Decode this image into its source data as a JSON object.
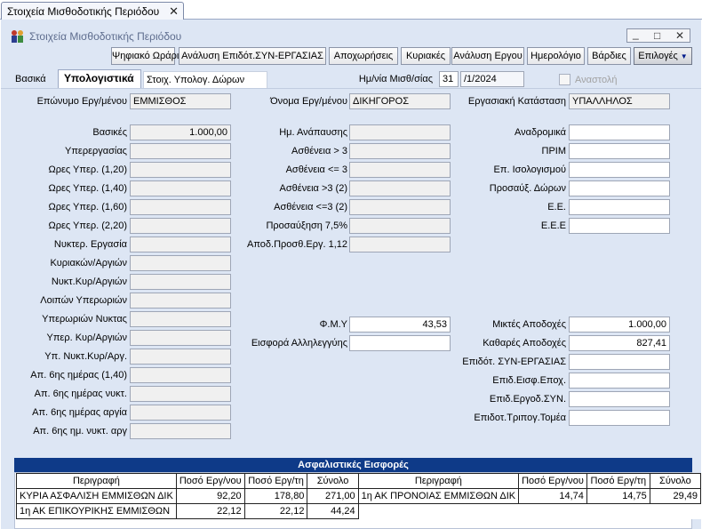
{
  "doc_tab": {
    "title": "Στοιχεία Μισθοδοτικής Περιόδου",
    "close": "✕"
  },
  "window": {
    "title": "Στοιχεία Μισθοδοτικής Περιόδου",
    "minimize": "_",
    "restore": "□",
    "close": "✕"
  },
  "toolbar": [
    "Ψηφιακό Ωράριο",
    "Ανάλυση Επιδότ.ΣΥΝ-ΕΡΓΑΣΙΑΣ",
    "Αποχωρήσεις",
    "Κυριακές",
    "Ανάλυση Εργου",
    "Ημερολόγιο",
    "Βάρδιες",
    "Επιλογές"
  ],
  "tabs": [
    "Βασικά",
    "Υπολογιστικά",
    "Στοιχ. Υπολογ. Δώρων"
  ],
  "payroll_date": {
    "label": "Ημ/νία Μισθ/σίας",
    "day": "31",
    "rest": "/1/2024"
  },
  "suspension": {
    "label": "Αναστολή"
  },
  "header_fields": {
    "surname_label": "Επώνυμο Εργ/μένου",
    "surname": "ΕΜΜΙΣΘΟΣ",
    "name_label": "Όνομα Εργ/μένου",
    "name": "ΔΙΚΗΓΟΡΟΣ",
    "status_label": "Εργασιακή Κατάσταση",
    "status": "ΥΠΑΛΛΗΛΟΣ"
  },
  "col1": [
    {
      "label": "Βασικές",
      "value": "1.000,00"
    },
    {
      "label": "Υπερεργασίας",
      "value": ""
    },
    {
      "label": "Ωρες Υπερ. (1,20)",
      "value": ""
    },
    {
      "label": "Ωρες Υπερ. (1,40)",
      "value": ""
    },
    {
      "label": "Ωρες Υπερ. (1,60)",
      "value": ""
    },
    {
      "label": "Ωρες Υπερ. (2,20)",
      "value": ""
    },
    {
      "label": "Νυκτερ. Εργασία",
      "value": ""
    },
    {
      "label": "Κυριακών/Αργιών",
      "value": ""
    },
    {
      "label": "Νυκτ.Κυρ/Αργιών",
      "value": ""
    },
    {
      "label": "Λοιπών Υπερωριών",
      "value": ""
    },
    {
      "label": "Υπερωριών Νυκτας",
      "value": ""
    },
    {
      "label": "Υπερ. Κυρ/Αργιών",
      "value": ""
    },
    {
      "label": "Υπ. Νυκτ.Κυρ/Αργ.",
      "value": ""
    },
    {
      "label": "Απ. 6ης ημέρας (1,40)",
      "value": ""
    },
    {
      "label": "Απ. 6ης ημέρας νυκτ.",
      "value": ""
    },
    {
      "label": "Απ. 6ης ημέρας αργία",
      "value": ""
    },
    {
      "label": "Απ. 6ης ημ. νυκτ. αργ",
      "value": ""
    }
  ],
  "col2": [
    {
      "label": "Ημ. Ανάπαυσης",
      "value": ""
    },
    {
      "label": "Ασθένεια > 3",
      "value": ""
    },
    {
      "label": "Ασθένεια <= 3",
      "value": ""
    },
    {
      "label": "Ασθένεια >3 (2)",
      "value": ""
    },
    {
      "label": "Ασθένεια <=3 (2)",
      "value": ""
    },
    {
      "label": "Προσαύξηση 7,5%",
      "value": ""
    },
    {
      "label": "Αποδ.Προσθ.Εργ. 1,12",
      "value": ""
    }
  ],
  "col2_bottom": [
    {
      "label": "Φ.Μ.Υ",
      "value": "43,53"
    },
    {
      "label": "Εισφορά Αλληλεγγύης",
      "value": ""
    }
  ],
  "col3": [
    {
      "label": "Αναδρομικά",
      "value": ""
    },
    {
      "label": "ΠΡΙΜ",
      "value": ""
    },
    {
      "label": "Επ. Ισολογισμού",
      "value": ""
    },
    {
      "label": "Προσαύξ. Δώρων",
      "value": ""
    },
    {
      "label": "Ε.Ε.",
      "value": ""
    },
    {
      "label": "Ε.Ε.Ε",
      "value": ""
    }
  ],
  "col3_bottom": [
    {
      "label": "Μικτές Αποδοχές",
      "value": "1.000,00"
    },
    {
      "label": "Καθαρές Αποδοχές",
      "value": "827,41"
    },
    {
      "label": "Επιδότ. ΣΥΝ-ΕΡΓΑΣΙΑΣ",
      "value": ""
    },
    {
      "label": "Επιδ.Εισφ.Εποχ.",
      "value": ""
    },
    {
      "label": "Επιδ.Εργοδ.ΣΥΝ.",
      "value": ""
    },
    {
      "label": "Επιδοτ.Τριπογ.Τομέα",
      "value": ""
    }
  ],
  "insurance": {
    "title": "Ασφαλιστικές Εισφορές",
    "headers": [
      "Περιγραφή",
      "Ποσό Εργ/νου",
      "Ποσό Εργ/τη",
      "Σύνολο",
      "Περιγραφή",
      "Ποσό Εργ/νου",
      "Ποσό Εργ/τη",
      "Σύνολο"
    ],
    "rows": [
      [
        "ΚΥΡΙΑ ΑΣΦΑΛΙΣΗ ΕΜΜΙΣΘΩΝ ΔΙΚ",
        "92,20",
        "178,80",
        "271,00",
        "1η ΑΚ ΠΡΟΝΟΙΑΣ ΕΜΜΙΣΘΩΝ ΔΙΚ",
        "14,74",
        "14,75",
        "29,49"
      ],
      [
        "1η ΑΚ ΕΠΙΚΟΥΡΙΚΗΣ ΕΜΜΙΣΘΩΝ",
        "22,12",
        "22,12",
        "44,24",
        "",
        "",
        "",
        ""
      ]
    ]
  }
}
